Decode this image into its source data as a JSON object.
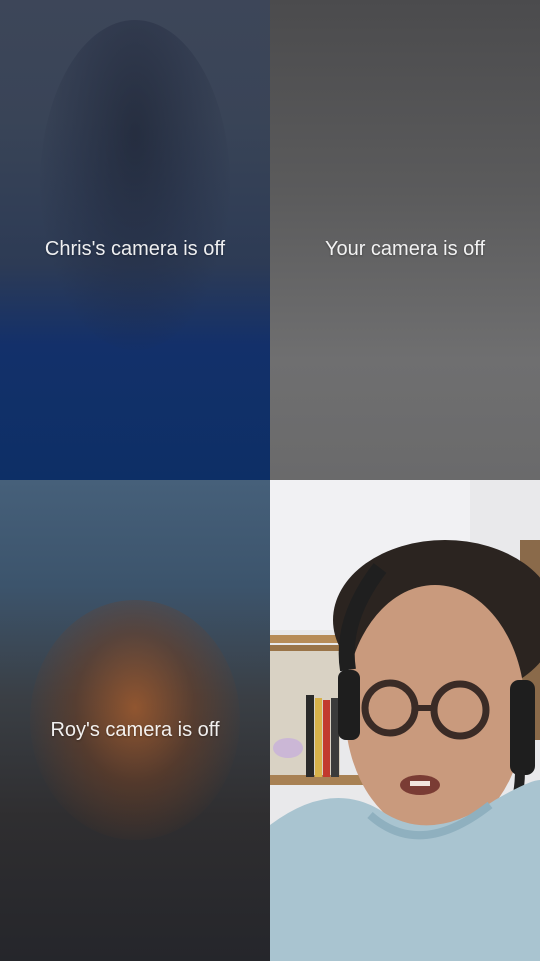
{
  "participants": [
    {
      "name": "Chris",
      "status_label": "Chris's camera is off",
      "camera_on": false
    },
    {
      "name": "You",
      "status_label": "Your camera is off",
      "camera_on": false
    },
    {
      "name": "Roy",
      "status_label": "Roy's camera is off",
      "camera_on": false
    },
    {
      "name": "",
      "status_label": "",
      "camera_on": true
    }
  ],
  "colors": {
    "label_text": "#ffffff",
    "chris_bg": "#0d2f66",
    "you_bg": "#5b5b5c",
    "roy_bg": "#25262b"
  }
}
